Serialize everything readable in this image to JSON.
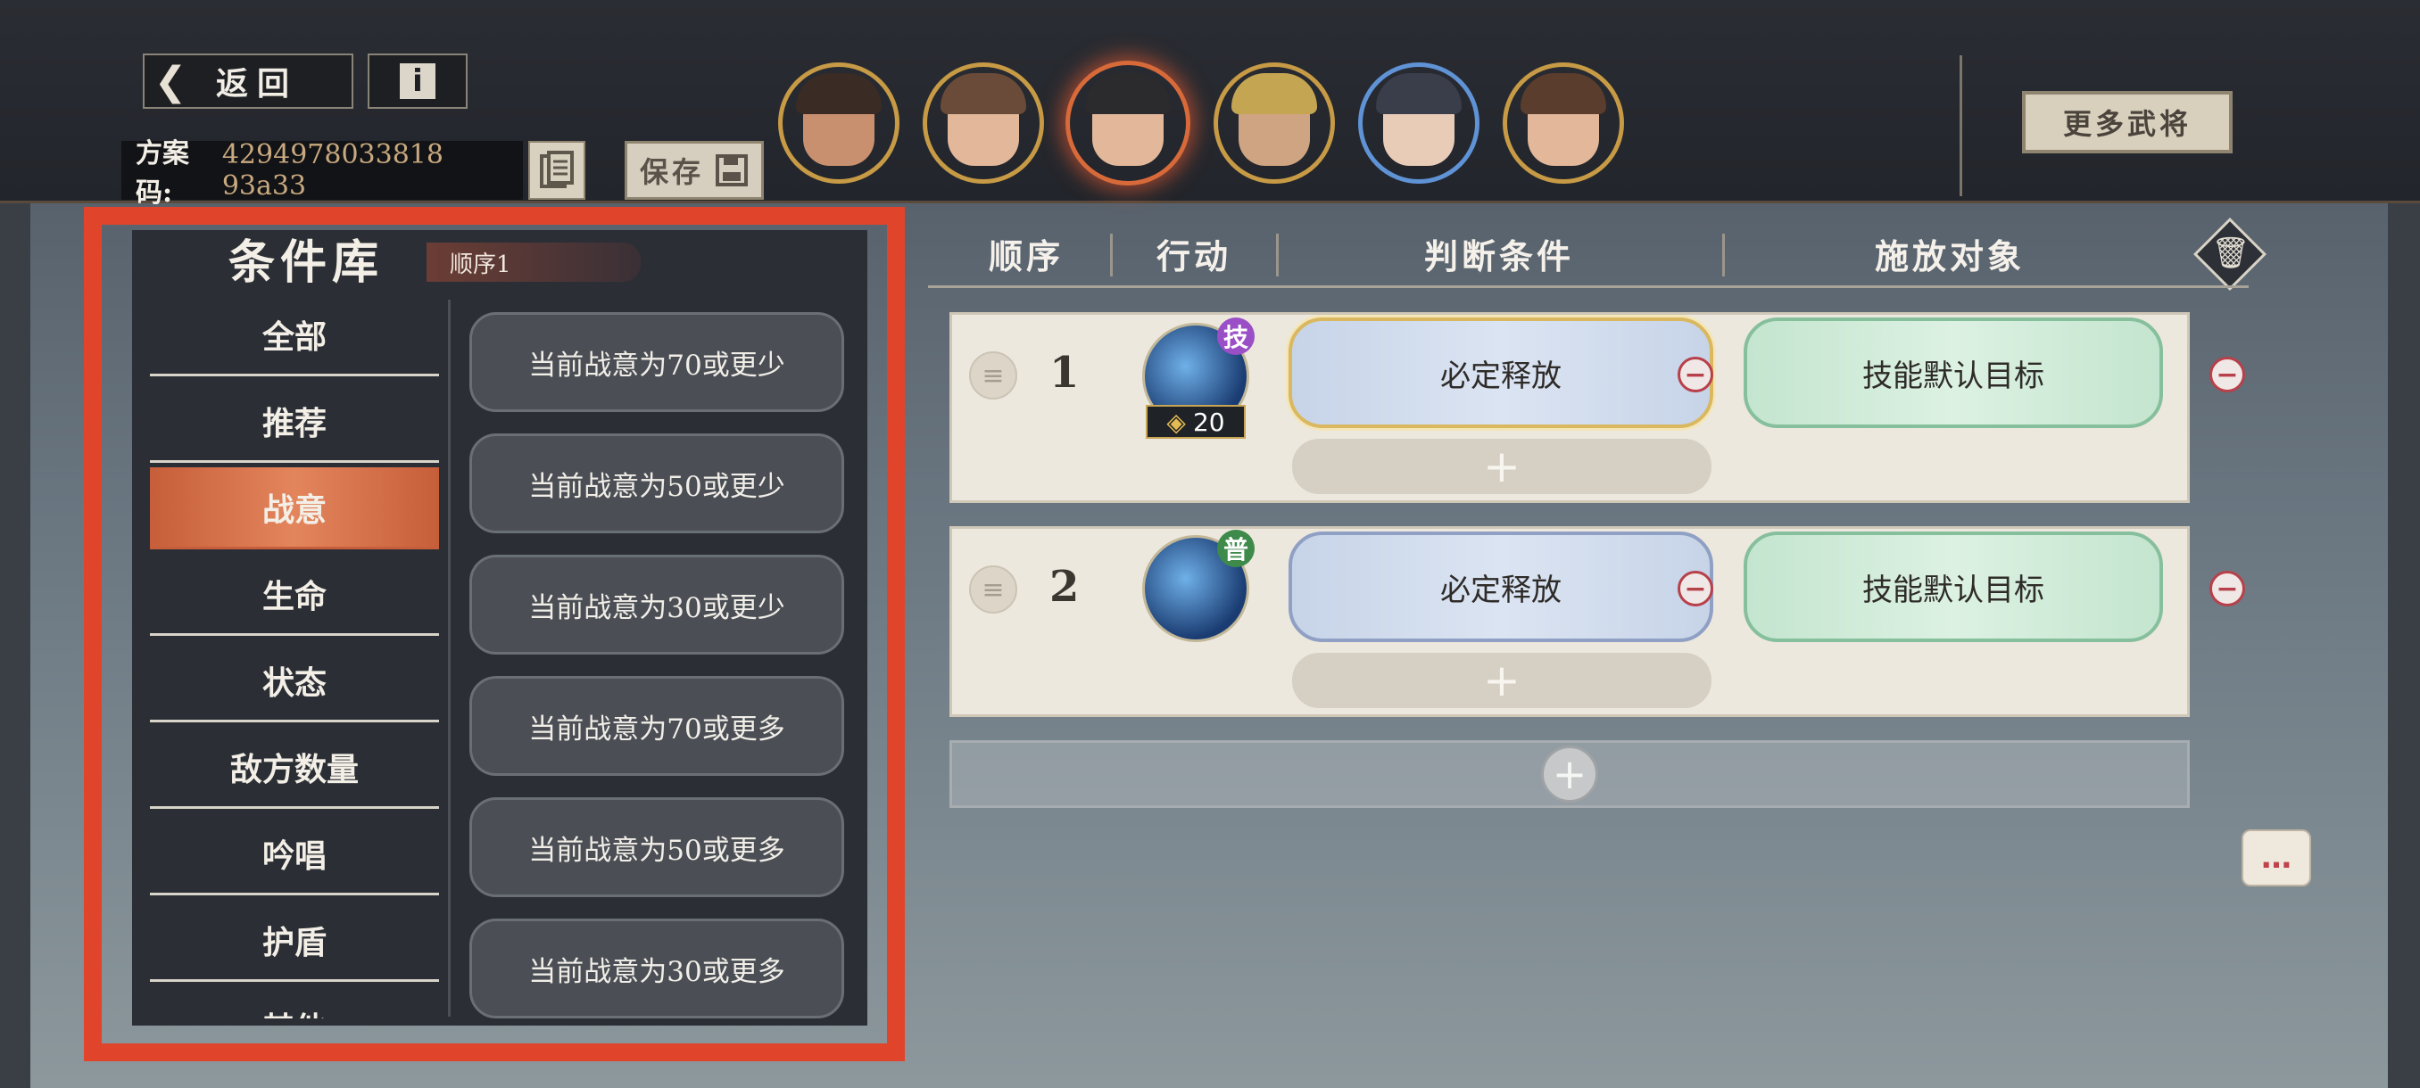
{
  "header": {
    "back_label": "返回",
    "code_label": "方案码:",
    "code_value": "4294978033818 93a33",
    "save_label": "保存",
    "more_label": "更多武将"
  },
  "heroes": [
    "hero-1",
    "hero-2",
    "hero-3",
    "hero-4",
    "hero-5",
    "hero-6"
  ],
  "library": {
    "title": "条件库",
    "badge": "顺序1",
    "categories": [
      "全部",
      "推荐",
      "战意",
      "生命",
      "状态",
      "敌方数量",
      "吟唱",
      "护盾",
      "其他"
    ],
    "active_category": "战意",
    "conditions": [
      "当前战意为70或更少",
      "当前战意为50或更少",
      "当前战意为30或更少",
      "当前战意为70或更多",
      "当前战意为50或更多",
      "当前战意为30或更多"
    ]
  },
  "table": {
    "headers": [
      "顺序",
      "行动",
      "判断条件",
      "施放对象"
    ],
    "rows": [
      {
        "num": "1",
        "tag": "技",
        "cost": "20",
        "condition": "必定释放",
        "target": "技能默认目标"
      },
      {
        "num": "2",
        "tag": "普",
        "cost": "",
        "condition": "必定释放",
        "target": "技能默认目标"
      }
    ]
  },
  "colors": {
    "accent": "#e0452b",
    "active_tab": "#d46e47"
  }
}
